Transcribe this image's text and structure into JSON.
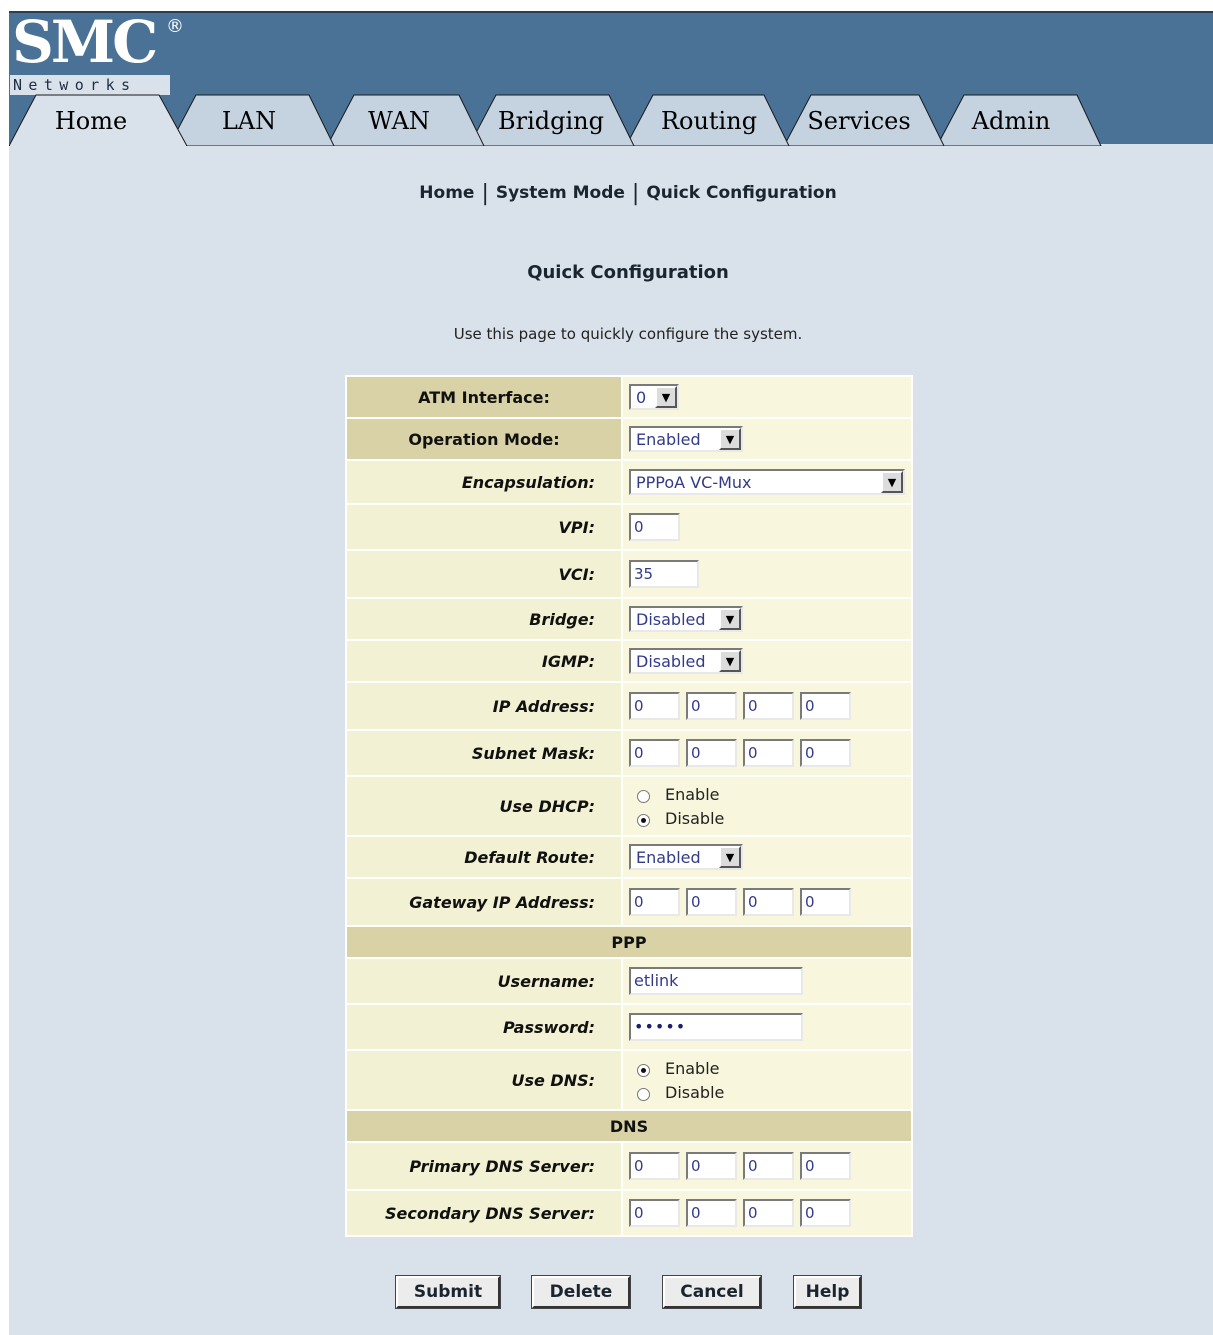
{
  "logo": {
    "brand": "SMC",
    "registered": "®",
    "tagline": "Networks"
  },
  "tabs": [
    {
      "label": "Home",
      "active": true
    },
    {
      "label": "LAN",
      "active": false
    },
    {
      "label": "WAN",
      "active": false
    },
    {
      "label": "Bridging",
      "active": false
    },
    {
      "label": "Routing",
      "active": false
    },
    {
      "label": "Services",
      "active": false
    },
    {
      "label": "Admin",
      "active": false
    }
  ],
  "breadcrumb": [
    "Home",
    "System Mode",
    "Quick Configuration"
  ],
  "breadcrumb_sep": "|",
  "page": {
    "title": "Quick Configuration",
    "description": "Use this page to quickly configure the system."
  },
  "form": {
    "atm_interface": {
      "label": "ATM Interface:",
      "value": "0"
    },
    "operation_mode": {
      "label": "Operation Mode:",
      "value": "Enabled"
    },
    "encapsulation": {
      "label": "Encapsulation:",
      "value": "PPPoA VC-Mux"
    },
    "vpi": {
      "label": "VPI:",
      "value": "0"
    },
    "vci": {
      "label": "VCI:",
      "value": "35"
    },
    "bridge": {
      "label": "Bridge:",
      "value": "Disabled"
    },
    "igmp": {
      "label": "IGMP:",
      "value": "Disabled"
    },
    "ip_address": {
      "label": "IP Address:",
      "octets": [
        "0",
        "0",
        "0",
        "0"
      ]
    },
    "subnet_mask": {
      "label": "Subnet Mask:",
      "octets": [
        "0",
        "0",
        "0",
        "0"
      ]
    },
    "use_dhcp": {
      "label": "Use DHCP:",
      "options": [
        "Enable",
        "Disable"
      ],
      "selected": "Disable"
    },
    "default_route": {
      "label": "Default Route:",
      "value": "Enabled"
    },
    "gateway_ip": {
      "label": "Gateway IP Address:",
      "octets": [
        "0",
        "0",
        "0",
        "0"
      ]
    },
    "ppp_section": "PPP",
    "username": {
      "label": "Username:",
      "value": "etlink"
    },
    "password": {
      "label": "Password:",
      "value": "•••••"
    },
    "use_dns": {
      "label": "Use DNS:",
      "options": [
        "Enable",
        "Disable"
      ],
      "selected": "Enable"
    },
    "dns_section": "DNS",
    "primary_dns": {
      "label": "Primary DNS Server:",
      "octets": [
        "0",
        "0",
        "0",
        "0"
      ]
    },
    "secondary_dns": {
      "label": "Secondary DNS Server:",
      "octets": [
        "0",
        "0",
        "0",
        "0"
      ]
    }
  },
  "buttons": {
    "submit": "Submit",
    "delete": "Delete",
    "cancel": "Cancel",
    "help": "Help"
  },
  "colors": {
    "header": "#4a7296",
    "page_bg": "#d9e1ea",
    "label_cell": "#f3f1d3",
    "section_cell": "#d8d2a6",
    "value_cell": "#f8f7de"
  }
}
